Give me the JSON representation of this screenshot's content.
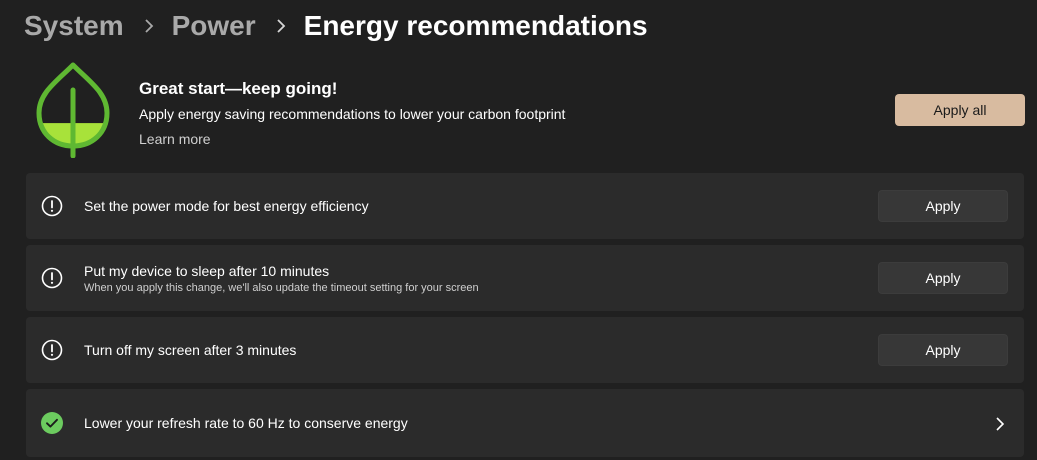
{
  "breadcrumb": {
    "items": [
      "System",
      "Power",
      "Energy recommendations"
    ]
  },
  "hero": {
    "icon": "leaf-icon",
    "title": "Great start—keep going!",
    "description": "Apply energy saving recommendations to lower your carbon footprint",
    "link": "Learn more",
    "apply_all_label": "Apply all",
    "leaf_fill_fraction": 0.3
  },
  "recommendations": [
    {
      "icon": "warning-circle-icon",
      "title": "Set the power mode for best energy efficiency",
      "subtitle": "",
      "action": "Apply",
      "status": "pending"
    },
    {
      "icon": "warning-circle-icon",
      "title": "Put my device to sleep after 10 minutes",
      "subtitle": "When you apply this change, we'll also update the timeout setting for your screen",
      "action": "Apply",
      "status": "pending"
    },
    {
      "icon": "warning-circle-icon",
      "title": "Turn off my screen after 3 minutes",
      "subtitle": "",
      "action": "Apply",
      "status": "pending"
    },
    {
      "icon": "check-circle-icon",
      "title": "Lower your refresh rate to 60 Hz to conserve energy",
      "subtitle": "",
      "action": "",
      "status": "done"
    }
  ],
  "colors": {
    "background": "#202020",
    "card": "#2b2b2b",
    "accent": "#d8bba0",
    "leaf_green": "#5fb832",
    "leaf_fill": "#a8e23a",
    "check_green": "#6ccb5f"
  }
}
